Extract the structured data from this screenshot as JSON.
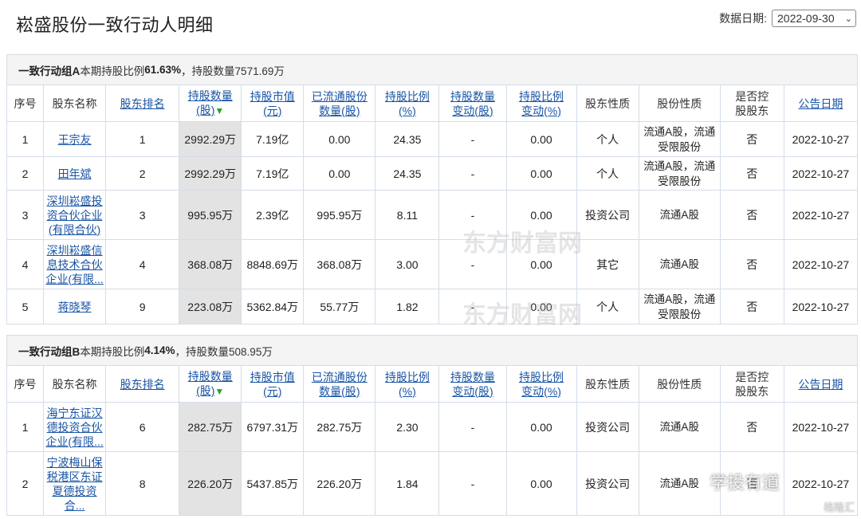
{
  "page": {
    "title": "崧盛股份一致行动人明细",
    "date_label": "数据日期:",
    "date_value": "2022-09-30"
  },
  "columns": {
    "seq": "序号",
    "name": "股东名称",
    "rank": "股东排名",
    "hold_qty_1": "持股数量",
    "hold_qty_2": "(股)",
    "hold_value_1": "持股市值",
    "hold_value_2": "(元)",
    "circ_1": "已流通股份",
    "circ_2": "数量(股)",
    "ratio_1": "持股比例",
    "ratio_2": "(%)",
    "qty_chg_1": "持股数量",
    "qty_chg_2": "变动(股)",
    "ratio_chg_1": "持股比例",
    "ratio_chg_2": "变动(%)",
    "nature": "股东性质",
    "share_type": "股份性质",
    "controlling_1": "是否控",
    "controlling_2": "股股东",
    "announce": "公告日期"
  },
  "groupA": {
    "label": "一致行动组A",
    "text1": "本期持股比例",
    "pct": "61.63%",
    "text2": "，持股数量7571.69万",
    "rows": [
      {
        "seq": "1",
        "name": [
          "王宗友"
        ],
        "rank": "1",
        "qty": "2992.29万",
        "value": "7.19亿",
        "circ": "0.00",
        "ratio": "24.35",
        "qchg": "-",
        "rchg": "0.00",
        "nature": "个人",
        "stype": [
          "流通A股，流通",
          "受限股份"
        ],
        "ctrl": "否",
        "date": "2022-10-27"
      },
      {
        "seq": "2",
        "name": [
          "田年斌"
        ],
        "rank": "2",
        "qty": "2992.29万",
        "value": "7.19亿",
        "circ": "0.00",
        "ratio": "24.35",
        "qchg": "-",
        "rchg": "0.00",
        "nature": "个人",
        "stype": [
          "流通A股，流通",
          "受限股份"
        ],
        "ctrl": "否",
        "date": "2022-10-27"
      },
      {
        "seq": "3",
        "name": [
          "深圳崧盛投",
          "资合伙企业",
          "(有限合伙)"
        ],
        "rank": "3",
        "qty": "995.95万",
        "value": "2.39亿",
        "circ": "995.95万",
        "ratio": "8.11",
        "qchg": "-",
        "rchg": "0.00",
        "nature": "投资公司",
        "stype": [
          "流通A股"
        ],
        "ctrl": "否",
        "date": "2022-10-27"
      },
      {
        "seq": "4",
        "name": [
          "深圳崧盛信",
          "息技术合伙",
          "企业(有限..."
        ],
        "rank": "4",
        "qty": "368.08万",
        "value": "8848.69万",
        "circ": "368.08万",
        "ratio": "3.00",
        "qchg": "-",
        "rchg": "0.00",
        "nature": "其它",
        "stype": [
          "流通A股"
        ],
        "ctrl": "否",
        "date": "2022-10-27"
      },
      {
        "seq": "5",
        "name": [
          "蒋晓琴"
        ],
        "rank": "9",
        "qty": "223.08万",
        "value": "5362.84万",
        "circ": "55.77万",
        "ratio": "1.82",
        "qchg": "-",
        "rchg": "0.00",
        "nature": "个人",
        "stype": [
          "流通A股，流通",
          "受限股份"
        ],
        "ctrl": "否",
        "date": "2022-10-27"
      }
    ]
  },
  "groupB": {
    "label": "一致行动组B",
    "text1": "本期持股比例",
    "pct": "4.14%",
    "text2": "，持股数量508.95万",
    "rows": [
      {
        "seq": "1",
        "name": [
          "海宁东证汉",
          "德投资合伙",
          "企业(有限..."
        ],
        "rank": "6",
        "qty": "282.75万",
        "value": "6797.31万",
        "circ": "282.75万",
        "ratio": "2.30",
        "qchg": "-",
        "rchg": "0.00",
        "nature": "投资公司",
        "stype": [
          "流通A股"
        ],
        "ctrl": "否",
        "date": "2022-10-27"
      },
      {
        "seq": "2",
        "name": [
          "宁波梅山保",
          "税港区东证",
          "夏德投资",
          "合..."
        ],
        "rank": "8",
        "qty": "226.20万",
        "value": "5437.85万",
        "circ": "226.20万",
        "ratio": "1.84",
        "qchg": "-",
        "rchg": "0.00",
        "nature": "投资公司",
        "stype": [
          "流通A股"
        ],
        "ctrl": "否",
        "date": "2022-10-27"
      }
    ]
  },
  "watermark": {
    "site": "东方财富网",
    "wechat": "学投有道",
    "source": "格隆汇"
  }
}
